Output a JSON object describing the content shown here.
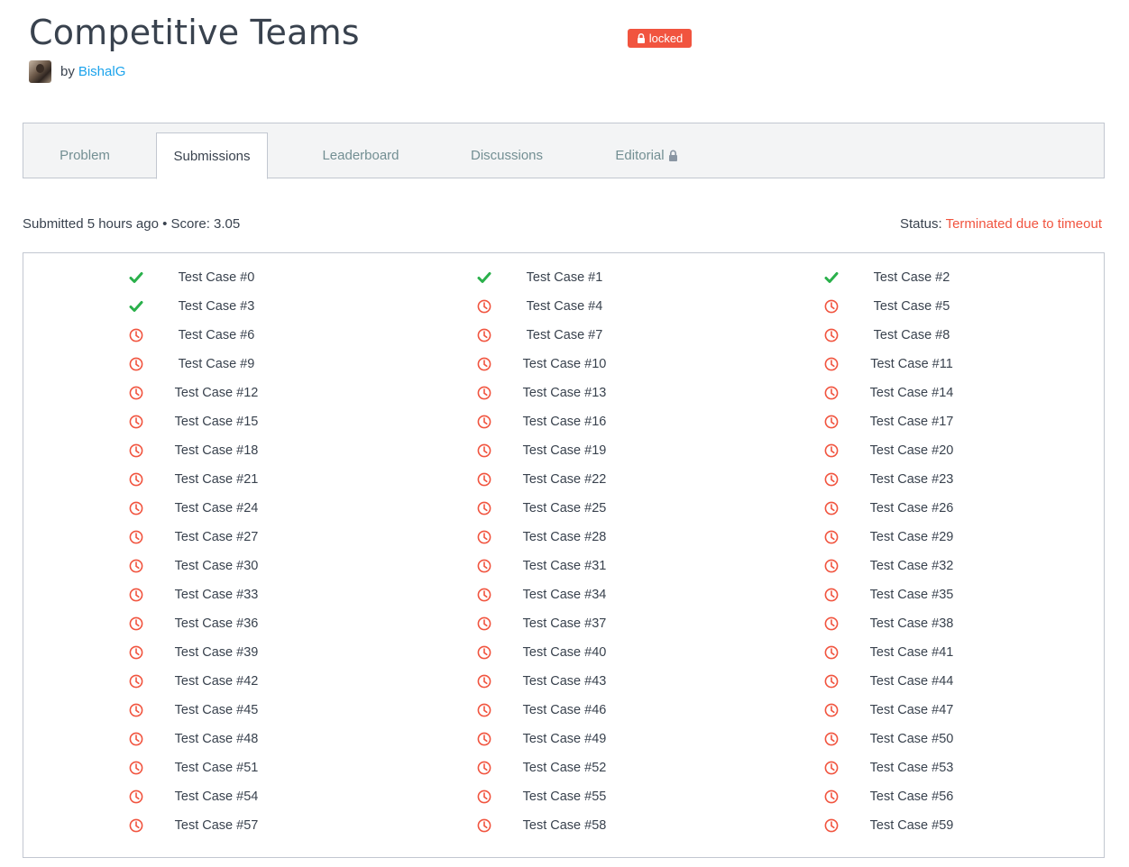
{
  "header": {
    "title": "Competitive Teams",
    "badge": "locked",
    "author_by": "by",
    "author_name": "BishalG"
  },
  "tabs": [
    {
      "label": "Problem",
      "active": false,
      "icon": null
    },
    {
      "label": "Submissions",
      "active": true,
      "icon": null
    },
    {
      "label": "Leaderboard",
      "active": false,
      "icon": null
    },
    {
      "label": "Discussions",
      "active": false,
      "icon": null
    },
    {
      "label": "Editorial",
      "active": false,
      "icon": "lock-icon"
    }
  ],
  "submission": {
    "submitted_text": "Submitted 5 hours ago • Score: 3.05",
    "status_label": "Status: ",
    "status_value": "Terminated due to timeout"
  },
  "colors": {
    "pass": "#2ab04b",
    "timeout": "#f1543f",
    "link": "#1ba3ec"
  },
  "test_cases": [
    {
      "label": "Test Case #0",
      "status": "pass"
    },
    {
      "label": "Test Case #1",
      "status": "pass"
    },
    {
      "label": "Test Case #2",
      "status": "pass"
    },
    {
      "label": "Test Case #3",
      "status": "pass"
    },
    {
      "label": "Test Case #4",
      "status": "timeout"
    },
    {
      "label": "Test Case #5",
      "status": "timeout"
    },
    {
      "label": "Test Case #6",
      "status": "timeout"
    },
    {
      "label": "Test Case #7",
      "status": "timeout"
    },
    {
      "label": "Test Case #8",
      "status": "timeout"
    },
    {
      "label": "Test Case #9",
      "status": "timeout"
    },
    {
      "label": "Test Case #10",
      "status": "timeout"
    },
    {
      "label": "Test Case #11",
      "status": "timeout"
    },
    {
      "label": "Test Case #12",
      "status": "timeout"
    },
    {
      "label": "Test Case #13",
      "status": "timeout"
    },
    {
      "label": "Test Case #14",
      "status": "timeout"
    },
    {
      "label": "Test Case #15",
      "status": "timeout"
    },
    {
      "label": "Test Case #16",
      "status": "timeout"
    },
    {
      "label": "Test Case #17",
      "status": "timeout"
    },
    {
      "label": "Test Case #18",
      "status": "timeout"
    },
    {
      "label": "Test Case #19",
      "status": "timeout"
    },
    {
      "label": "Test Case #20",
      "status": "timeout"
    },
    {
      "label": "Test Case #21",
      "status": "timeout"
    },
    {
      "label": "Test Case #22",
      "status": "timeout"
    },
    {
      "label": "Test Case #23",
      "status": "timeout"
    },
    {
      "label": "Test Case #24",
      "status": "timeout"
    },
    {
      "label": "Test Case #25",
      "status": "timeout"
    },
    {
      "label": "Test Case #26",
      "status": "timeout"
    },
    {
      "label": "Test Case #27",
      "status": "timeout"
    },
    {
      "label": "Test Case #28",
      "status": "timeout"
    },
    {
      "label": "Test Case #29",
      "status": "timeout"
    },
    {
      "label": "Test Case #30",
      "status": "timeout"
    },
    {
      "label": "Test Case #31",
      "status": "timeout"
    },
    {
      "label": "Test Case #32",
      "status": "timeout"
    },
    {
      "label": "Test Case #33",
      "status": "timeout"
    },
    {
      "label": "Test Case #34",
      "status": "timeout"
    },
    {
      "label": "Test Case #35",
      "status": "timeout"
    },
    {
      "label": "Test Case #36",
      "status": "timeout"
    },
    {
      "label": "Test Case #37",
      "status": "timeout"
    },
    {
      "label": "Test Case #38",
      "status": "timeout"
    },
    {
      "label": "Test Case #39",
      "status": "timeout"
    },
    {
      "label": "Test Case #40",
      "status": "timeout"
    },
    {
      "label": "Test Case #41",
      "status": "timeout"
    },
    {
      "label": "Test Case #42",
      "status": "timeout"
    },
    {
      "label": "Test Case #43",
      "status": "timeout"
    },
    {
      "label": "Test Case #44",
      "status": "timeout"
    },
    {
      "label": "Test Case #45",
      "status": "timeout"
    },
    {
      "label": "Test Case #46",
      "status": "timeout"
    },
    {
      "label": "Test Case #47",
      "status": "timeout"
    },
    {
      "label": "Test Case #48",
      "status": "timeout"
    },
    {
      "label": "Test Case #49",
      "status": "timeout"
    },
    {
      "label": "Test Case #50",
      "status": "timeout"
    },
    {
      "label": "Test Case #51",
      "status": "timeout"
    },
    {
      "label": "Test Case #52",
      "status": "timeout"
    },
    {
      "label": "Test Case #53",
      "status": "timeout"
    },
    {
      "label": "Test Case #54",
      "status": "timeout"
    },
    {
      "label": "Test Case #55",
      "status": "timeout"
    },
    {
      "label": "Test Case #56",
      "status": "timeout"
    },
    {
      "label": "Test Case #57",
      "status": "timeout"
    },
    {
      "label": "Test Case #58",
      "status": "timeout"
    },
    {
      "label": "Test Case #59",
      "status": "timeout"
    }
  ]
}
